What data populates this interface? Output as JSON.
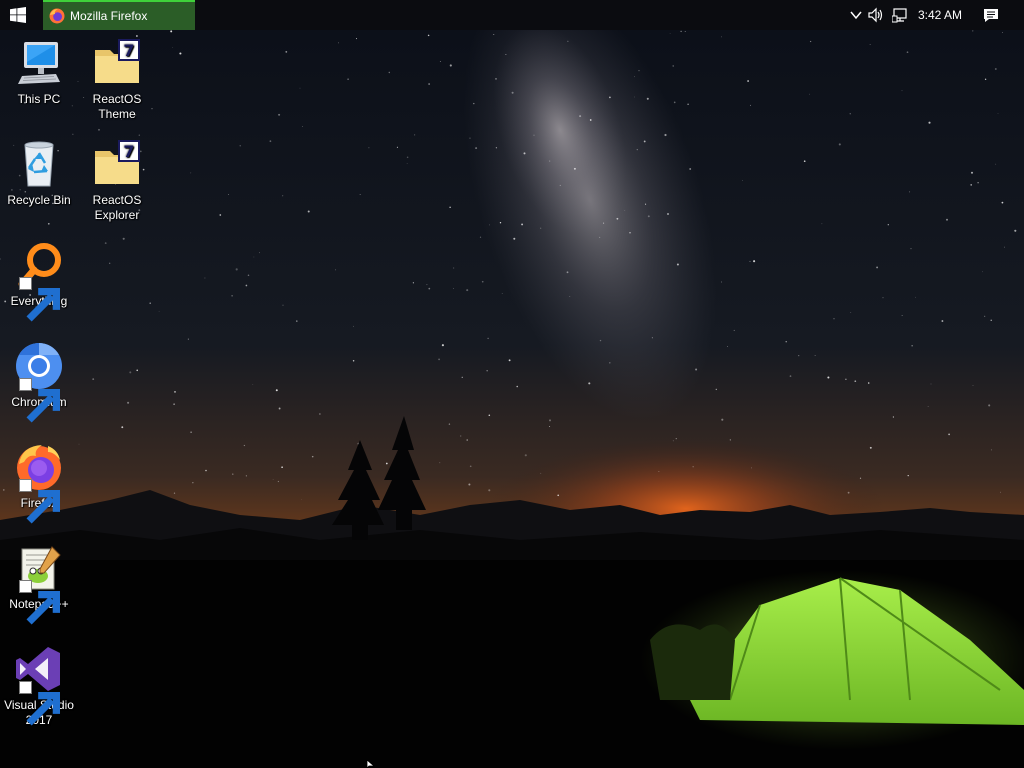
{
  "taskbar": {
    "start": {
      "icon": "windows-logo-icon"
    },
    "tasks": [
      {
        "label": "Mozilla Firefox",
        "icon": "firefox-icon"
      }
    ],
    "tray": {
      "chevron_icon": "chevron-up-icon",
      "volume_icon": "speaker-icon",
      "network_icon": "network-icon",
      "clock": "3:42 AM",
      "notification_icon": "action-center-icon"
    }
  },
  "desktop": {
    "icons": [
      {
        "label": "This PC",
        "icon": "computer-icon"
      },
      {
        "label": "ReactOS Theme",
        "icon": "7zip-archive-icon"
      },
      {
        "label": "Recycle Bin",
        "icon": "recycle-bin-icon"
      },
      {
        "label": "ReactOS Explorer",
        "icon": "7zip-archive-icon"
      },
      {
        "label": "Everything",
        "icon": "everything-search-icon"
      },
      {
        "label": "Chromium",
        "icon": "chromium-icon"
      },
      {
        "label": "Firefox",
        "icon": "firefox-icon"
      },
      {
        "label": "Notepad++",
        "icon": "notepad-plus-plus-icon"
      },
      {
        "label": "Visual Studio 2017",
        "icon": "visual-studio-icon"
      }
    ]
  },
  "colors": {
    "taskbar_bg": "#0b0c10",
    "active_task_bg": "#2b5d27",
    "active_task_accent": "#3fd13a",
    "tent_green": "#8ee03a"
  }
}
